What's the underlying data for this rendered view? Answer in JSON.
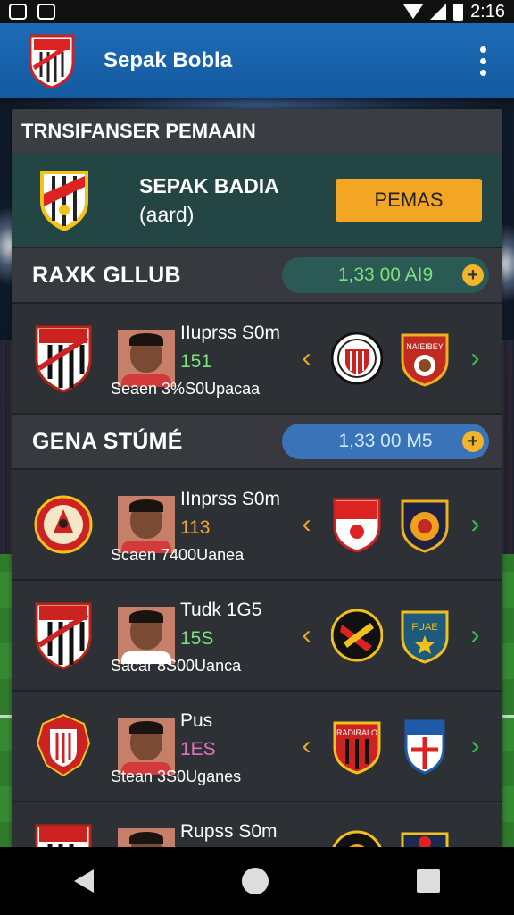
{
  "status": {
    "time": "2:16"
  },
  "appbar": {
    "title": "Sepak Bobla"
  },
  "panel": {
    "title": "TRNSIFANSER PEMAAIN"
  },
  "hero": {
    "name": "SEPAK BADIA",
    "sub": "(aard)",
    "button": "PEMAS"
  },
  "sections": [
    {
      "title": "RAXK GLLUB",
      "pill": "1,33 00 AI9",
      "rows": [
        {
          "name": "IIuprss S0m",
          "num": "151",
          "num_color": "#7ee07a",
          "sub": "Seaen 3%S0Upacaa"
        }
      ]
    },
    {
      "title": "GENA STÚMÉ",
      "pill": "1,33 00 M5",
      "rows": [
        {
          "name": "IInprss S0m",
          "num": "113",
          "num_color": "#f0a830",
          "sub": "Scaen 7400Uanea"
        },
        {
          "name": "Tudk 1G5",
          "num": "15S",
          "num_color": "#7ee07a",
          "sub": "Sacar 8S00Uanca"
        },
        {
          "name": "Pus",
          "num": "1ES",
          "num_color": "#e074c0",
          "sub": "Stean 3S0Uganes"
        },
        {
          "name": "Rupss S0m",
          "num": "",
          "num_color": "#7ee07a",
          "sub": ""
        }
      ]
    }
  ],
  "badge_text": {
    "b2": "NAIEIBEY",
    "b6": "FUAE",
    "b7": "RADIRALO"
  },
  "colors": {
    "appbar": "#1d6bb8",
    "accent": "#f2a623",
    "green": "#37c24e",
    "panel": "#2a2d32"
  }
}
